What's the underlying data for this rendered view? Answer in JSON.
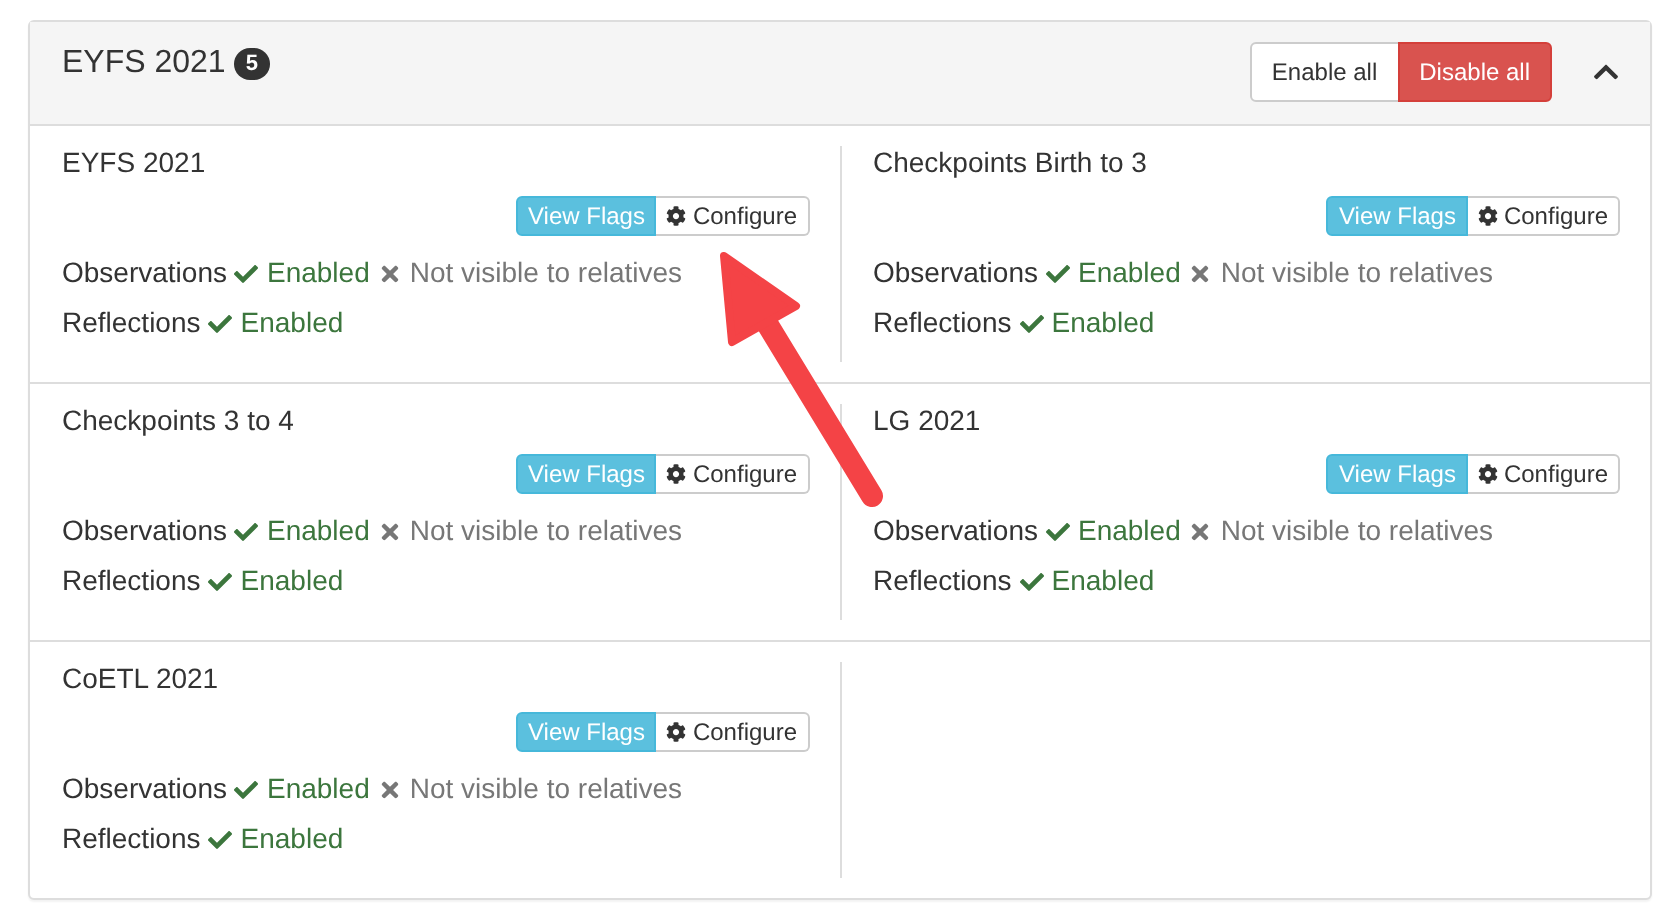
{
  "panel": {
    "title": "EYFS 2021",
    "badge": "5",
    "expanded": true,
    "actions": [
      {
        "label": "Enable all",
        "kind": "default"
      },
      {
        "label": "Disable all",
        "kind": "danger"
      }
    ]
  },
  "modules": [
    {
      "name": "EYFS 2021",
      "view": "View Flags",
      "configure": "Configure",
      "settings": [
        {
          "label": "Observations",
          "flags": [
            {
              "text": "Enabled",
              "on": true
            },
            {
              "text": "Not visible to relatives",
              "on": false
            }
          ]
        },
        {
          "label": "Reflections",
          "flags": [
            {
              "text": "Enabled",
              "on": true
            }
          ]
        }
      ]
    },
    {
      "name": "Checkpoints Birth to 3",
      "view": "View Flags",
      "configure": "Configure",
      "settings": [
        {
          "label": "Observations",
          "flags": [
            {
              "text": "Enabled",
              "on": true
            },
            {
              "text": "Not visible to relatives",
              "on": false
            }
          ]
        },
        {
          "label": "Reflections",
          "flags": [
            {
              "text": "Enabled",
              "on": true
            }
          ]
        }
      ]
    },
    {
      "name": "Checkpoints 3 to 4",
      "view": "View Flags",
      "configure": "Configure",
      "settings": [
        {
          "label": "Observations",
          "flags": [
            {
              "text": "Enabled",
              "on": true
            },
            {
              "text": "Not visible to relatives",
              "on": false
            }
          ]
        },
        {
          "label": "Reflections",
          "flags": [
            {
              "text": "Enabled",
              "on": true
            }
          ]
        }
      ]
    },
    {
      "name": "LG 2021",
      "view": "View Flags",
      "configure": "Configure",
      "settings": [
        {
          "label": "Observations",
          "flags": [
            {
              "text": "Enabled",
              "on": true
            },
            {
              "text": "Not visible to relatives",
              "on": false
            }
          ]
        },
        {
          "label": "Reflections",
          "flags": [
            {
              "text": "Enabled",
              "on": true
            }
          ]
        }
      ]
    },
    {
      "name": "CoETL 2021",
      "view": "View Flags",
      "configure": "Configure",
      "settings": [
        {
          "label": "Observations",
          "flags": [
            {
              "text": "Enabled",
              "on": true
            },
            {
              "text": "Not visible to relatives",
              "on": false
            }
          ]
        },
        {
          "label": "Reflections",
          "flags": [
            {
              "text": "Enabled",
              "on": true
            }
          ]
        }
      ]
    }
  ]
}
